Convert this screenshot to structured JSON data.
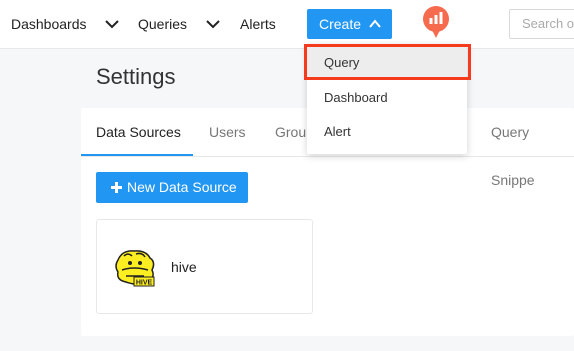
{
  "navbar": {
    "dashboards_label": "Dashboards",
    "queries_label": "Queries",
    "alerts_label": "Alerts",
    "create_label": "Create",
    "search_placeholder": "Search o",
    "logo_icon": "redash-logo-icon",
    "accent_color": "#2196f3"
  },
  "create_menu": {
    "items": [
      {
        "label": "Query"
      },
      {
        "label": "Dashboard"
      },
      {
        "label": "Alert"
      }
    ],
    "highlight_color": "#f63a1e"
  },
  "page": {
    "title": "Settings"
  },
  "tabs": [
    {
      "label": "Data Sources",
      "active": true
    },
    {
      "label": "Users"
    },
    {
      "label": "Group"
    },
    {
      "label": "Query Snippe"
    }
  ],
  "data_sources": {
    "new_button_label": "New Data Source",
    "items": [
      {
        "name": "hive",
        "icon": "hive-logo-icon"
      }
    ]
  }
}
